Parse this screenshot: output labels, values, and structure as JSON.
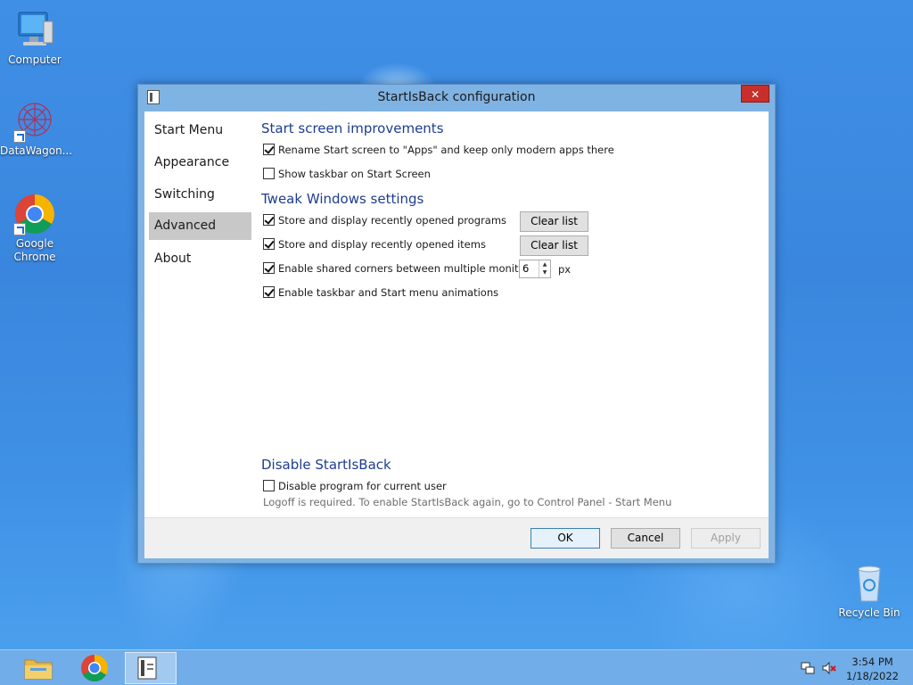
{
  "desktop": {
    "icons": [
      {
        "label": "Computer"
      },
      {
        "label": "DataWagon..."
      },
      {
        "label": "Google Chrome"
      },
      {
        "label": "Recycle Bin"
      }
    ]
  },
  "window": {
    "title": "StartIsBack configuration",
    "close_glyph": "✕",
    "nav": [
      {
        "label": "Start Menu"
      },
      {
        "label": "Appearance"
      },
      {
        "label": "Switching"
      },
      {
        "label": "Advanced",
        "selected": true
      },
      {
        "label": "About"
      }
    ],
    "sections": {
      "start_screen": {
        "title": "Start screen improvements",
        "options": [
          {
            "label": "Rename Start screen to \"Apps\" and keep only modern apps there",
            "checked": true
          },
          {
            "label": "Show taskbar on Start Screen",
            "checked": false
          }
        ]
      },
      "tweak": {
        "title": "Tweak Windows settings",
        "options": [
          {
            "label": "Store and display recently opened programs",
            "checked": true,
            "button": "Clear list"
          },
          {
            "label": "Store and display recently opened items",
            "checked": true,
            "button": "Clear list"
          },
          {
            "label": "Enable shared corners between multiple monitors",
            "checked": true
          },
          {
            "label": "Enable taskbar and Start menu animations",
            "checked": true
          }
        ],
        "corner_spin": {
          "value": "6",
          "unit": "px"
        }
      },
      "disable": {
        "title": "Disable StartIsBack",
        "option": {
          "label": "Disable program for current user",
          "checked": false
        },
        "note": "Logoff is required. To enable StartIsBack again, go to Control Panel - Start Menu"
      }
    },
    "buttons": {
      "ok": "OK",
      "cancel": "Cancel",
      "apply": "Apply"
    }
  },
  "taskbar": {
    "time": "3:54 PM",
    "date": "1/18/2022"
  },
  "colors": {
    "section_title": "#1e3d8f",
    "close_button": "#c7302a",
    "selected_nav": "#c8c8c8"
  }
}
